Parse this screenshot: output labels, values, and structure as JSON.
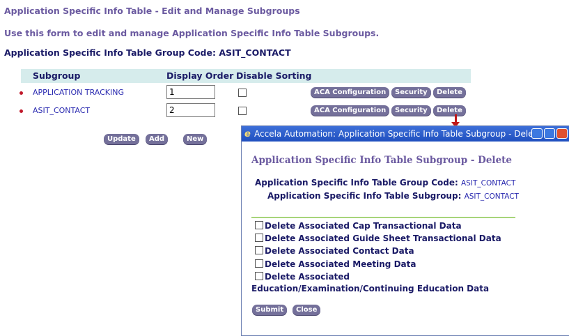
{
  "page": {
    "title": "Application Specific Info Table - Edit and Manage Subgroups",
    "description": "Use this form to edit and manage Application Specific Info Table Subgroups.",
    "group_code_label": "Application Specific Info Table Group Code:",
    "group_code_value": "ASIT_CONTACT"
  },
  "table": {
    "headers": [
      "Subgroup",
      "Display Order",
      "Disable Sorting"
    ],
    "rows": [
      {
        "subgroup": "APPLICATION TRACKING",
        "order": "1"
      },
      {
        "subgroup": "ASIT_CONTACT",
        "order": "2"
      }
    ],
    "row_actions": [
      "ACA Configuration",
      "Security",
      "Delete"
    ]
  },
  "actions": {
    "update": "Update",
    "add": "Add",
    "new": "New"
  },
  "popup": {
    "window_title": "Accela Automation: Application Specific Info Table Subgroup - Dele...",
    "heading": "Application Specific Info Table Subgroup - Delete",
    "group_code_label": "Application Specific Info Table Group Code:",
    "group_code_value": "ASIT_CONTACT",
    "subgroup_label": "Application Specific Info Table Subgroup:",
    "subgroup_value": "ASIT_CONTACT",
    "options": [
      "Delete Associated Cap Transactional Data",
      "Delete Associated Guide Sheet Transactional Data",
      "Delete Associated Contact Data",
      "Delete Associated Meeting Data",
      "Delete Associated"
    ],
    "option_continuation": "Education/Examination/Continuing Education Data",
    "submit": "Submit",
    "close": "Close"
  },
  "colors": {
    "accent_purple": "#6b5aa0",
    "button_bg": "#74709a",
    "header_bg": "#d6ecec",
    "link_blue": "#2a2ab0"
  }
}
